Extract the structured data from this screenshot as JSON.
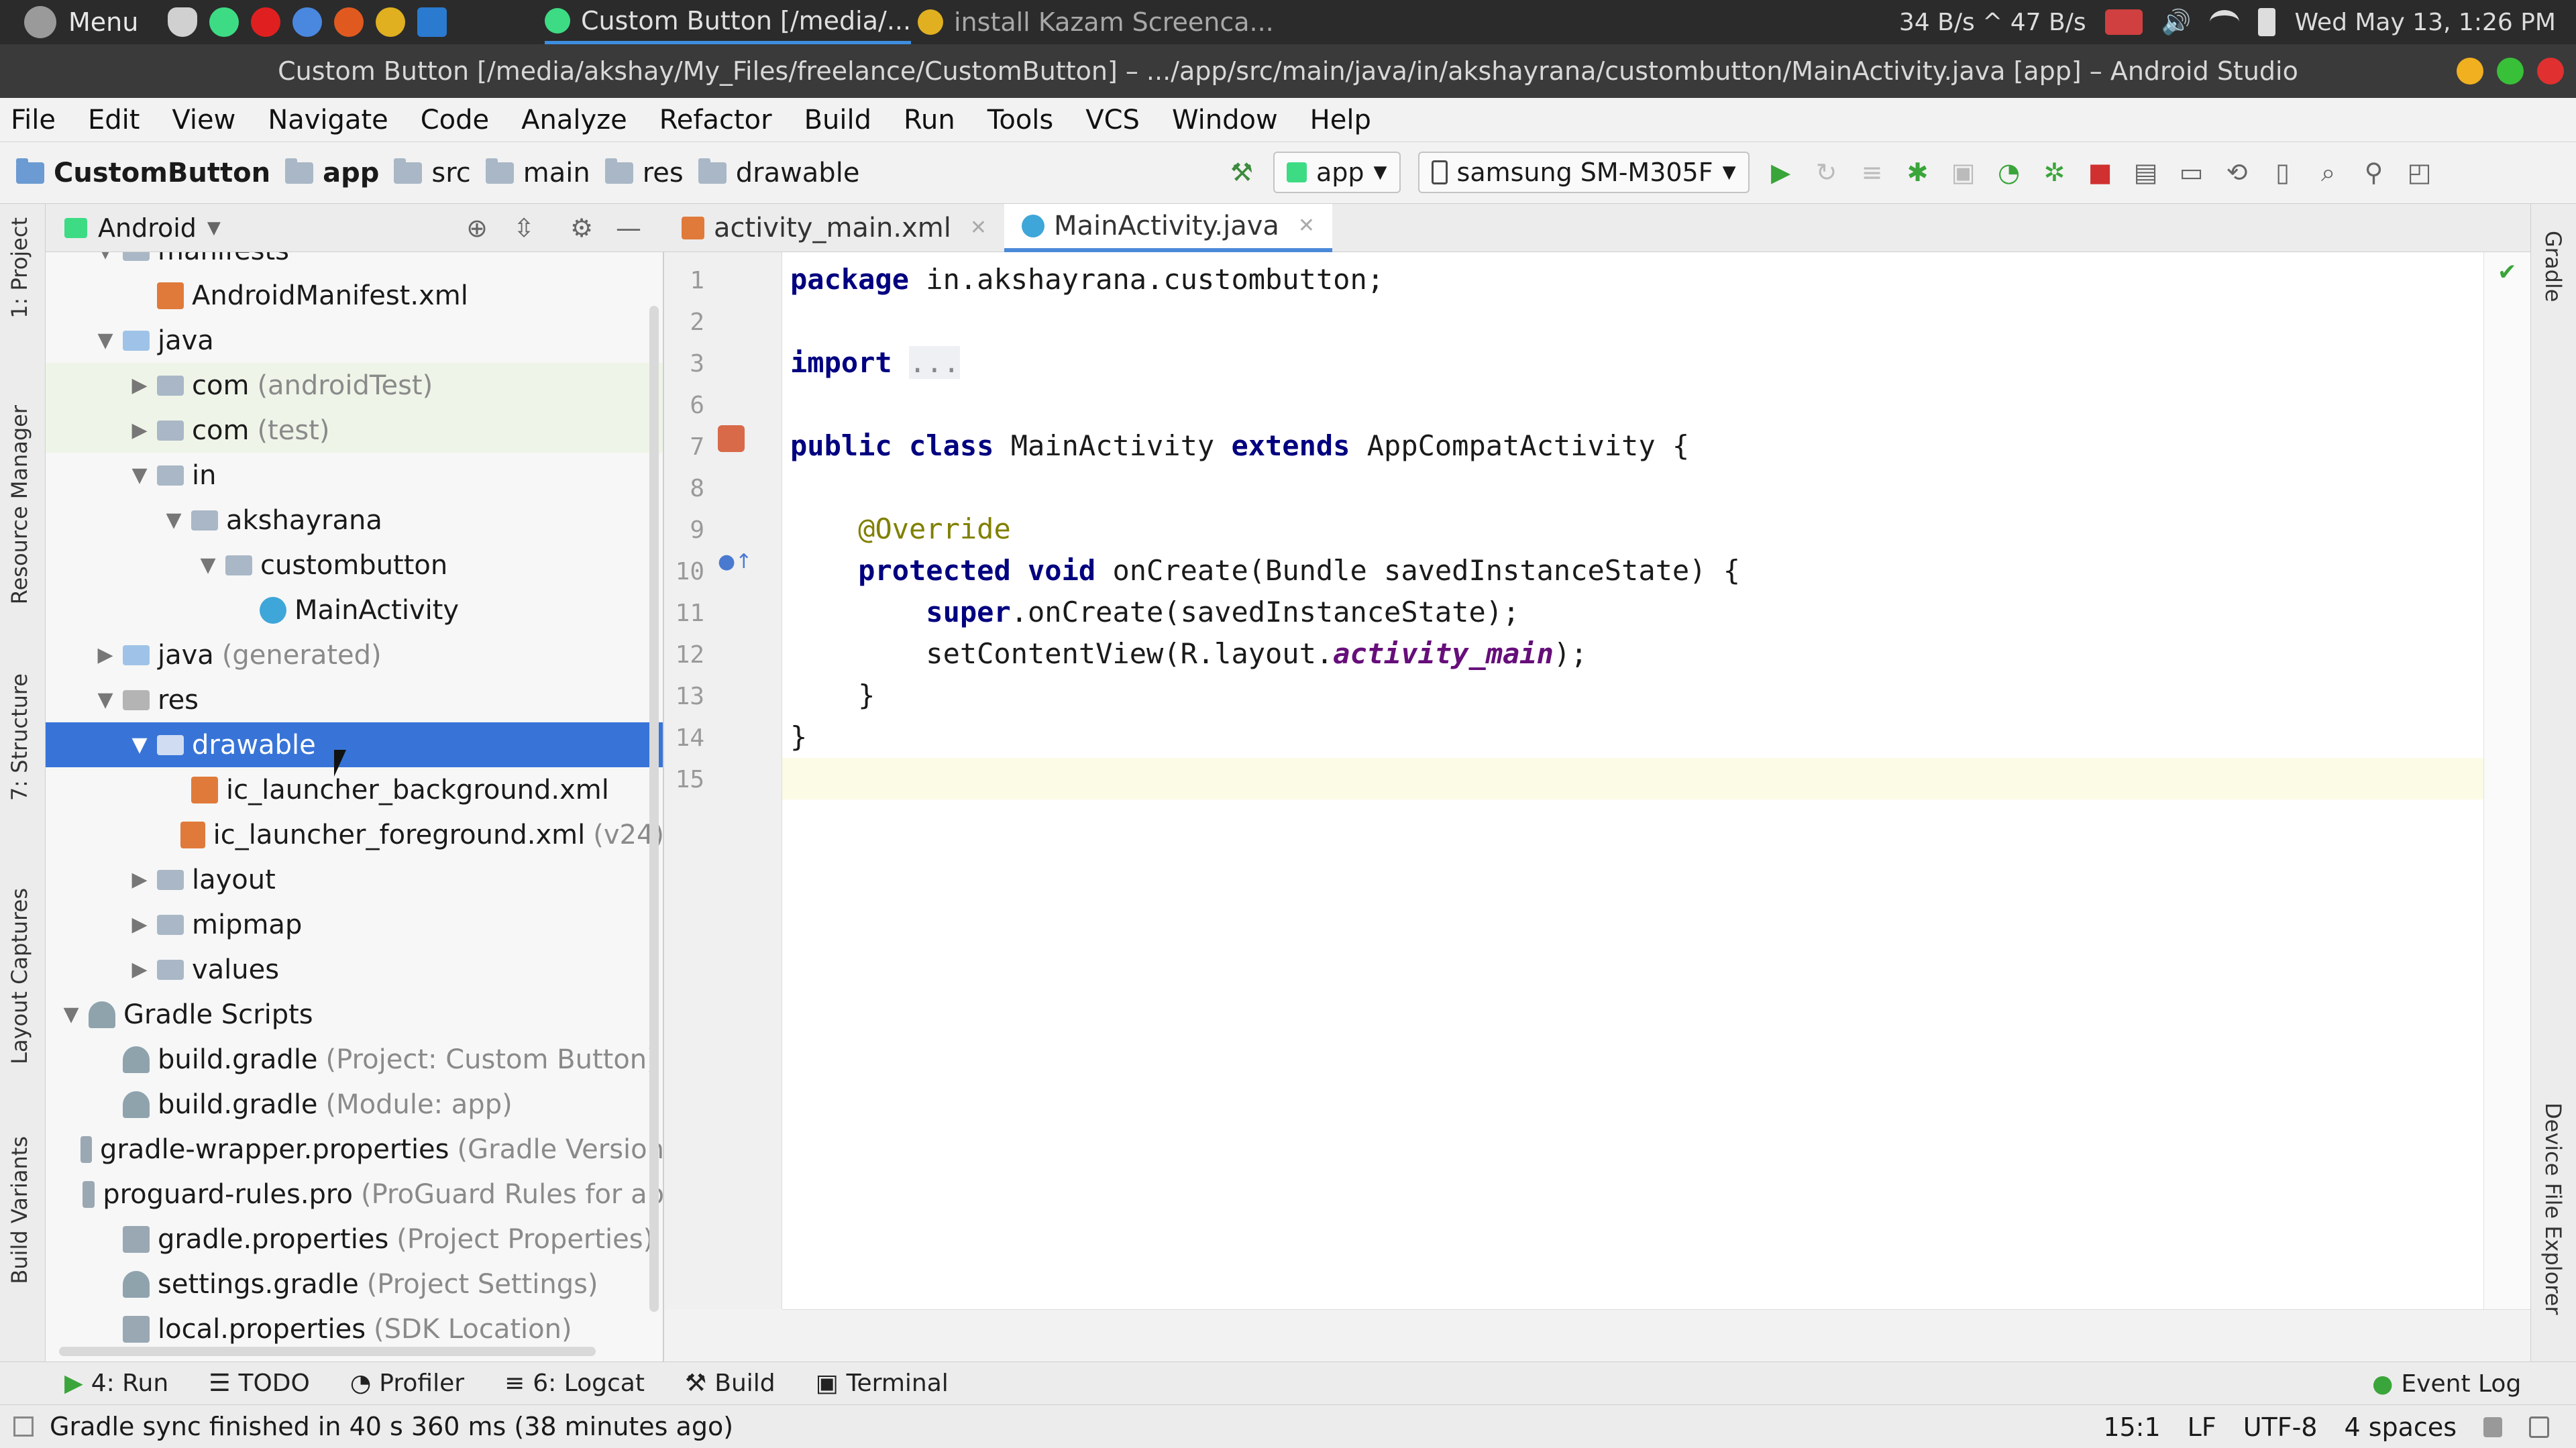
{
  "taskbar": {
    "menu_label": "Menu",
    "tasks": [
      {
        "label": "Custom Button [/media/..."
      },
      {
        "label": "install Kazam Screenca..."
      }
    ],
    "net_speed": "34 B/s ^ 47 B/s",
    "clock": "Wed May 13, 1:26 PM"
  },
  "window": {
    "title": "Custom Button [/media/akshay/My_Files/freelance/CustomButton] – .../app/src/main/java/in/akshayrana/custombutton/MainActivity.java [app] – Android Studio"
  },
  "menu": [
    "File",
    "Edit",
    "View",
    "Navigate",
    "Code",
    "Analyze",
    "Refactor",
    "Build",
    "Run",
    "Tools",
    "VCS",
    "Window",
    "Help"
  ],
  "breadcrumbs": [
    "CustomButton",
    "app",
    "src",
    "main",
    "res",
    "drawable"
  ],
  "toolbar": {
    "run_config": "app",
    "device": "samsung SM-M305F"
  },
  "side_tools_left": [
    "1: Project",
    "Resource Manager",
    "7: Structure",
    "Layout Captures",
    "Build Variants"
  ],
  "side_tools_right": [
    "Gradle",
    "Device File Explorer"
  ],
  "project": {
    "view_mode": "Android",
    "tree": [
      {
        "label": "manifests",
        "extra": "",
        "indent": 1,
        "arrow": "down",
        "icon": "folder"
      },
      {
        "label": "AndroidManifest.xml",
        "extra": "",
        "indent": 2,
        "arrow": "",
        "icon": "xml"
      },
      {
        "label": "java",
        "extra": "",
        "indent": 1,
        "arrow": "down",
        "icon": "java"
      },
      {
        "label": "com",
        "extra": "(androidTest)",
        "indent": 2,
        "arrow": "right",
        "icon": "folder",
        "tint": true
      },
      {
        "label": "com",
        "extra": "(test)",
        "indent": 2,
        "arrow": "right",
        "icon": "folder",
        "tint": true
      },
      {
        "label": "in",
        "extra": "",
        "indent": 2,
        "arrow": "down",
        "icon": "folder"
      },
      {
        "label": "akshayrana",
        "extra": "",
        "indent": 3,
        "arrow": "down",
        "icon": "folder"
      },
      {
        "label": "custombutton",
        "extra": "",
        "indent": 4,
        "arrow": "down",
        "icon": "folder"
      },
      {
        "label": "MainActivity",
        "extra": "",
        "indent": 5,
        "arrow": "",
        "icon": "class"
      },
      {
        "label": "java",
        "extra": "(generated)",
        "indent": 1,
        "arrow": "right",
        "icon": "java"
      },
      {
        "label": "res",
        "extra": "",
        "indent": 1,
        "arrow": "down",
        "icon": "res"
      },
      {
        "label": "drawable",
        "extra": "",
        "indent": 2,
        "arrow": "down",
        "icon": "folder",
        "selected": true
      },
      {
        "label": "ic_launcher_background.xml",
        "extra": "",
        "indent": 3,
        "arrow": "",
        "icon": "xml"
      },
      {
        "label": "ic_launcher_foreground.xml",
        "extra": "(v24)",
        "indent": 3,
        "arrow": "",
        "icon": "xml"
      },
      {
        "label": "layout",
        "extra": "",
        "indent": 2,
        "arrow": "right",
        "icon": "folder"
      },
      {
        "label": "mipmap",
        "extra": "",
        "indent": 2,
        "arrow": "right",
        "icon": "folder"
      },
      {
        "label": "values",
        "extra": "",
        "indent": 2,
        "arrow": "right",
        "icon": "folder"
      },
      {
        "label": "Gradle Scripts",
        "extra": "",
        "indent": 0,
        "arrow": "down",
        "icon": "gradle"
      },
      {
        "label": "build.gradle",
        "extra": "(Project: Custom Button)",
        "indent": 1,
        "arrow": "",
        "icon": "gradle"
      },
      {
        "label": "build.gradle",
        "extra": "(Module: app)",
        "indent": 1,
        "arrow": "",
        "icon": "gradle"
      },
      {
        "label": "gradle-wrapper.properties",
        "extra": "(Gradle Version",
        "indent": 1,
        "arrow": "",
        "icon": "prop"
      },
      {
        "label": "proguard-rules.pro",
        "extra": "(ProGuard Rules for ap",
        "indent": 1,
        "arrow": "",
        "icon": "prop"
      },
      {
        "label": "gradle.properties",
        "extra": "(Project Properties)",
        "indent": 1,
        "arrow": "",
        "icon": "prop"
      },
      {
        "label": "settings.gradle",
        "extra": "(Project Settings)",
        "indent": 1,
        "arrow": "",
        "icon": "gradle"
      },
      {
        "label": "local.properties",
        "extra": "(SDK Location)",
        "indent": 1,
        "arrow": "",
        "icon": "prop"
      }
    ]
  },
  "editor": {
    "tabs": [
      {
        "label": "activity_main.xml",
        "active": false,
        "icon": "xml"
      },
      {
        "label": "MainActivity.java",
        "active": true,
        "icon": "class"
      }
    ],
    "lines": [
      {
        "n": "1",
        "html": "<span class=\"kw\">package</span> in.akshayrana.custombutton;"
      },
      {
        "n": "2",
        "html": ""
      },
      {
        "n": "3",
        "html": "<span class=\"kw\">import</span> <span class=\"fold\">...</span>"
      },
      {
        "n": "6",
        "html": ""
      },
      {
        "n": "7",
        "html": "<span class=\"kw\">public class</span> MainActivity <span class=\"kw\">extends</span> AppCompatActivity {"
      },
      {
        "n": "8",
        "html": ""
      },
      {
        "n": "9",
        "html": "    <span class=\"ann\">@Override</span>"
      },
      {
        "n": "10",
        "html": "    <span class=\"kw\">protected void</span> onCreate(Bundle savedInstanceState) {"
      },
      {
        "n": "11",
        "html": "        <span class=\"kw\">super</span>.onCreate(savedInstanceState);"
      },
      {
        "n": "12",
        "html": "        setContentView(R.layout.<span class=\"ital\">activity_main</span>);"
      },
      {
        "n": "13",
        "html": "    }"
      },
      {
        "n": "14",
        "html": "}"
      },
      {
        "n": "15",
        "html": ""
      }
    ]
  },
  "bottom_tools": [
    "4: Run",
    "TODO",
    "Profiler",
    "6: Logcat",
    "Build",
    "Terminal"
  ],
  "event_log": "Event Log",
  "status": {
    "message": "Gradle sync finished in 40 s 360 ms (38 minutes ago)",
    "position": "15:1",
    "line_sep": "LF",
    "encoding": "UTF-8",
    "indent": "4 spaces"
  }
}
